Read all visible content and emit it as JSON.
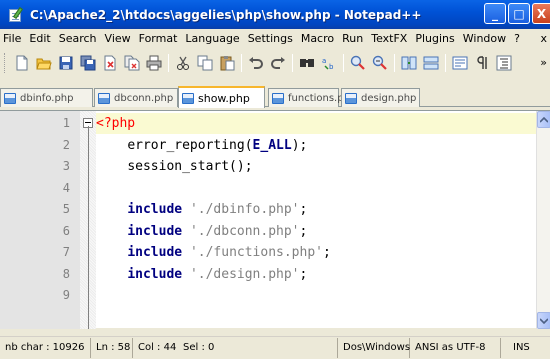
{
  "window": {
    "title": "C:\\Apache2_2\\htdocs\\aggelies\\php\\show.php - Notepad++",
    "minimize_glyph": "_",
    "maximize_glyph": "□",
    "close_glyph": "X"
  },
  "menubar": {
    "items": [
      "File",
      "Edit",
      "Search",
      "View",
      "Format",
      "Language",
      "Settings",
      "Macro",
      "Run",
      "TextFX",
      "Plugins",
      "Window",
      "?"
    ],
    "overflow": "x"
  },
  "toolbar": {
    "icons": [
      "new-file-icon",
      "open-file-icon",
      "save-icon",
      "save-all-icon",
      "close-icon",
      "close-all-icon",
      "print-icon",
      "cut-icon",
      "copy-icon",
      "paste-icon",
      "undo-icon",
      "redo-icon",
      "find-icon",
      "replace-icon",
      "zoom-in-icon",
      "zoom-out-icon",
      "sync-vertical-icon",
      "sync-horizontal-icon",
      "word-wrap-icon",
      "show-all-chars-icon",
      "indent-guide-icon"
    ],
    "overflow": "»"
  },
  "tabs": [
    {
      "label": "dbinfo.php",
      "active": false
    },
    {
      "label": "dbconn.php",
      "active": false
    },
    {
      "label": "show.php",
      "active": true
    },
    {
      "label": "functions.php",
      "active": false
    },
    {
      "label": "design.php",
      "active": false
    }
  ],
  "editor": {
    "lines": [
      {
        "num": "1",
        "indent": "",
        "tokens": [
          {
            "t": "<?php",
            "c": "kw-php"
          }
        ]
      },
      {
        "num": "2",
        "indent": "    ",
        "tokens": [
          {
            "t": "error_reporting(",
            "c": ""
          },
          {
            "t": "E_ALL",
            "c": "const"
          },
          {
            "t": ");",
            "c": ""
          }
        ]
      },
      {
        "num": "3",
        "indent": "    ",
        "tokens": [
          {
            "t": "session_start();",
            "c": ""
          }
        ]
      },
      {
        "num": "4",
        "indent": "",
        "tokens": []
      },
      {
        "num": "5",
        "indent": "    ",
        "tokens": [
          {
            "t": "include",
            "c": "kw"
          },
          {
            "t": " ",
            "c": ""
          },
          {
            "t": "'./dbinfo.php'",
            "c": "str"
          },
          {
            "t": ";",
            "c": ""
          }
        ]
      },
      {
        "num": "6",
        "indent": "    ",
        "tokens": [
          {
            "t": "include",
            "c": "kw"
          },
          {
            "t": " ",
            "c": ""
          },
          {
            "t": "'./dbconn.php'",
            "c": "str"
          },
          {
            "t": ";",
            "c": ""
          }
        ]
      },
      {
        "num": "7",
        "indent": "    ",
        "tokens": [
          {
            "t": "include",
            "c": "kw"
          },
          {
            "t": " ",
            "c": ""
          },
          {
            "t": "'./functions.php'",
            "c": "str"
          },
          {
            "t": ";",
            "c": ""
          }
        ]
      },
      {
        "num": "8",
        "indent": "    ",
        "tokens": [
          {
            "t": "include",
            "c": "kw"
          },
          {
            "t": " ",
            "c": ""
          },
          {
            "t": "'./design.php'",
            "c": "str"
          },
          {
            "t": ";",
            "c": ""
          }
        ]
      },
      {
        "num": "9",
        "indent": "",
        "tokens": []
      }
    ]
  },
  "statusbar": {
    "nb_char": "nb char : 10926",
    "ln": "Ln : 58",
    "col": "Col : 44",
    "sel": "Sel : 0",
    "eol": "Dos\\Windows",
    "encoding": "ANSI as UTF-8",
    "mode": "INS"
  },
  "colors": {
    "titlebar": "#0052d6",
    "php_tag": "#ff0000",
    "keyword": "#000080",
    "string": "#808080",
    "current_line": "#fafad2",
    "active_tab_accent": "#f7b62d"
  }
}
